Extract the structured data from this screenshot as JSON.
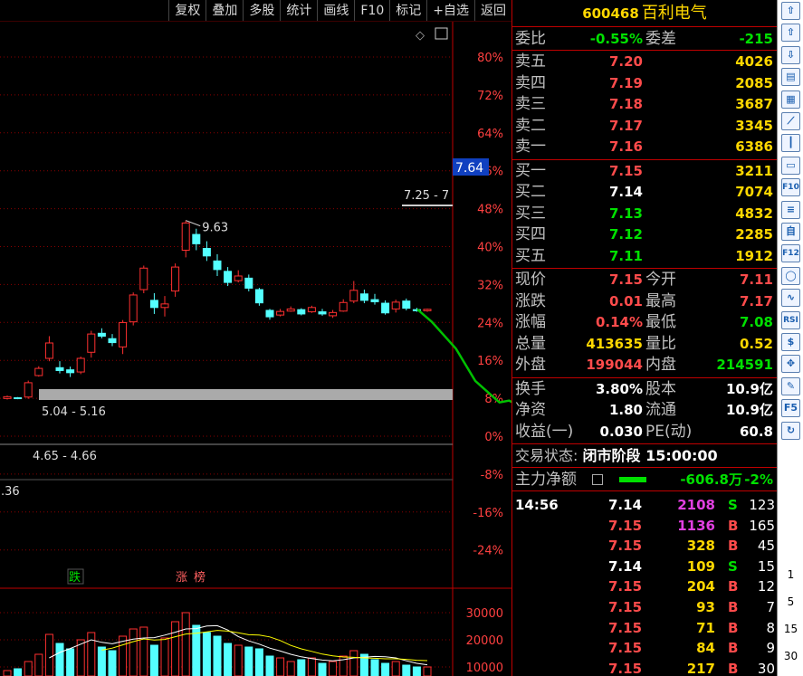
{
  "toolbar": [
    "复权",
    "叠加",
    "多股",
    "统计",
    "画线",
    "F10",
    "标记",
    "+自选",
    "返回"
  ],
  "chart_labels": {
    "current_price": "7.64",
    "high_mark": "9.63",
    "range_label_mid": "5.04 - 5.16",
    "range_label_low": "4.65 - 4.66",
    "range_label_right": "7.25 - 7",
    "left_cut_value": ".36",
    "event_fall": "跌",
    "event_limit1": "涨",
    "event_limit2": "榜"
  },
  "chart_data": {
    "type": "candlestick",
    "pct_axis": [
      "80%",
      "72%",
      "64%",
      "56%",
      "48%",
      "40%",
      "32%",
      "24%",
      "16%",
      "8%",
      "0%",
      "-8%",
      "-16%",
      "-24%"
    ],
    "volume_axis": [
      "30000",
      "20000",
      "10000"
    ],
    "candles": [
      {
        "o": 4.66,
        "c": 4.71,
        "h": 4.74,
        "l": 4.63
      },
      {
        "o": 4.68,
        "c": 4.66,
        "h": 4.7,
        "l": 4.64
      },
      {
        "o": 4.7,
        "c": 5.1,
        "h": 5.16,
        "l": 4.65
      },
      {
        "o": 5.3,
        "c": 5.5,
        "h": 5.56,
        "l": 5.27
      },
      {
        "o": 5.78,
        "c": 6.21,
        "h": 6.4,
        "l": 5.7
      },
      {
        "o": 5.52,
        "c": 5.44,
        "h": 5.7,
        "l": 5.36
      },
      {
        "o": 5.46,
        "c": 5.38,
        "h": 5.55,
        "l": 5.26
      },
      {
        "o": 5.4,
        "c": 5.78,
        "h": 5.83,
        "l": 5.34
      },
      {
        "o": 5.95,
        "c": 6.46,
        "h": 6.55,
        "l": 5.8
      },
      {
        "o": 6.48,
        "c": 6.4,
        "h": 6.62,
        "l": 6.34
      },
      {
        "o": 6.33,
        "c": 6.22,
        "h": 6.46,
        "l": 6.12
      },
      {
        "o": 6.1,
        "c": 6.78,
        "h": 6.85,
        "l": 5.9
      },
      {
        "o": 6.8,
        "c": 7.55,
        "h": 7.62,
        "l": 6.7
      },
      {
        "o": 7.7,
        "c": 8.3,
        "h": 8.37,
        "l": 7.6
      },
      {
        "o": 7.4,
        "c": 7.2,
        "h": 7.6,
        "l": 7.02
      },
      {
        "o": 7.2,
        "c": 7.3,
        "h": 7.52,
        "l": 6.95
      },
      {
        "o": 7.66,
        "c": 8.33,
        "h": 8.43,
        "l": 7.5
      },
      {
        "o": 8.8,
        "c": 9.56,
        "h": 9.63,
        "l": 8.6
      },
      {
        "o": 9.24,
        "c": 8.98,
        "h": 9.4,
        "l": 8.8
      },
      {
        "o": 8.85,
        "c": 8.64,
        "h": 9.05,
        "l": 8.5
      },
      {
        "o": 8.5,
        "c": 8.26,
        "h": 8.69,
        "l": 8.08
      },
      {
        "o": 8.21,
        "c": 7.9,
        "h": 8.33,
        "l": 7.8
      },
      {
        "o": 7.95,
        "c": 8.08,
        "h": 8.24,
        "l": 7.9
      },
      {
        "o": 8.02,
        "c": 7.74,
        "h": 8.12,
        "l": 7.65
      },
      {
        "o": 7.7,
        "c": 7.33,
        "h": 7.75,
        "l": 7.25
      },
      {
        "o": 7.12,
        "c": 6.94,
        "h": 7.16,
        "l": 6.86
      },
      {
        "o": 6.99,
        "c": 7.09,
        "h": 7.16,
        "l": 6.95
      },
      {
        "o": 7.1,
        "c": 7.16,
        "h": 7.23,
        "l": 7.08
      },
      {
        "o": 7.14,
        "c": 7.02,
        "h": 7.18,
        "l": 6.98
      },
      {
        "o": 7.08,
        "c": 7.2,
        "h": 7.25,
        "l": 7.05
      },
      {
        "o": 7.08,
        "c": 7.02,
        "h": 7.16,
        "l": 6.97
      },
      {
        "o": 6.97,
        "c": 7.06,
        "h": 7.13,
        "l": 6.91
      },
      {
        "o": 7.1,
        "c": 7.34,
        "h": 7.43,
        "l": 7.08
      },
      {
        "o": 7.38,
        "c": 7.68,
        "h": 7.94,
        "l": 7.32
      },
      {
        "o": 7.58,
        "c": 7.4,
        "h": 7.7,
        "l": 7.32
      },
      {
        "o": 7.42,
        "c": 7.36,
        "h": 7.58,
        "l": 7.28
      },
      {
        "o": 7.32,
        "c": 7.05,
        "h": 7.4,
        "l": 7.0
      },
      {
        "o": 7.16,
        "c": 7.35,
        "h": 7.42,
        "l": 7.06
      },
      {
        "o": 7.38,
        "c": 7.18,
        "h": 7.45,
        "l": 7.12
      },
      {
        "o": 7.14,
        "c": 7.11,
        "h": 7.19,
        "l": 7.08
      },
      {
        "o": 7.11,
        "c": 7.15,
        "h": 7.17,
        "l": 7.08
      }
    ],
    "volume": [
      3,
      4,
      8,
      12,
      23,
      18,
      15,
      20,
      24,
      16,
      14,
      22,
      26,
      27,
      17,
      21,
      30,
      35,
      28,
      24,
      22,
      18,
      17,
      16,
      15,
      11,
      10,
      8,
      9,
      10,
      7,
      8,
      11,
      14,
      12,
      9,
      7,
      8,
      6,
      5,
      5
    ],
    "forecast": [
      [
        7.15,
        0
      ],
      [
        6.8,
        0.3
      ],
      [
        6.05,
        0.8
      ],
      [
        5.15,
        1.2
      ],
      [
        4.55,
        1.7
      ],
      [
        4.6,
        1.9
      ],
      [
        4.4,
        2.2
      ],
      [
        3.55,
        3.0
      ]
    ]
  },
  "quote": {
    "code": "600468",
    "name": "百利电气",
    "weibi": {
      "label1": "委比",
      "val1": "-0.55%",
      "label2": "委差",
      "val2": "-215"
    },
    "sells": [
      {
        "label": "卖五",
        "price": "7.20",
        "vol": "4026"
      },
      {
        "label": "卖四",
        "price": "7.19",
        "vol": "2085"
      },
      {
        "label": "卖三",
        "price": "7.18",
        "vol": "3687"
      },
      {
        "label": "卖二",
        "price": "7.17",
        "vol": "3345"
      },
      {
        "label": "卖一",
        "price": "7.16",
        "vol": "6386"
      }
    ],
    "buys": [
      {
        "label": "买一",
        "price": "7.15",
        "vol": "3211"
      },
      {
        "label": "买二",
        "price": "7.14",
        "vol": "7074"
      },
      {
        "label": "买三",
        "price": "7.13",
        "vol": "4832"
      },
      {
        "label": "买四",
        "price": "7.12",
        "vol": "2285"
      },
      {
        "label": "买五",
        "price": "7.11",
        "vol": "1912"
      }
    ],
    "stats1": [
      {
        "l1": "现价",
        "v1": "7.15",
        "l2": "今开",
        "v2": "7.11"
      },
      {
        "l1": "涨跌",
        "v1": "0.01",
        "l2": "最高",
        "v2": "7.17"
      },
      {
        "l1": "涨幅",
        "v1": "0.14%",
        "l2": "最低",
        "v2": "7.08"
      },
      {
        "l1": "总量",
        "v1": "413635",
        "l2": "量比",
        "v2": "0.52"
      },
      {
        "l1": "外盘",
        "v1": "199044",
        "l2": "内盘",
        "v2": "214591"
      }
    ],
    "stats2": [
      {
        "l1": "换手",
        "v1": "3.80%",
        "l2": "股本",
        "v2": "10.9亿"
      },
      {
        "l1": "净资",
        "v1": "1.80",
        "l2": "流通",
        "v2": "10.9亿"
      },
      {
        "l1": "收益(一)",
        "v1": "0.030",
        "l2": "PE(动)",
        "v2": "60.8"
      }
    ],
    "status_label": "交易状态:",
    "status_value": "闭市阶段 15:00:00",
    "main_flow_label": "主力净额",
    "main_flow_value": "-606.8万",
    "main_flow_pct": "-2%",
    "ticks": [
      {
        "time": "14:56",
        "price": "7.14",
        "vol": "2108",
        "side": "S",
        "count": "123"
      },
      {
        "time": "",
        "price": "7.15",
        "vol": "1136",
        "side": "B",
        "count": "165"
      },
      {
        "time": "",
        "price": "7.15",
        "vol": "328",
        "side": "B",
        "count": "45"
      },
      {
        "time": "",
        "price": "7.14",
        "vol": "109",
        "side": "S",
        "count": "15"
      },
      {
        "time": "",
        "price": "7.15",
        "vol": "204",
        "side": "B",
        "count": "12"
      },
      {
        "time": "",
        "price": "7.15",
        "vol": "93",
        "side": "B",
        "count": "7"
      },
      {
        "time": "",
        "price": "7.15",
        "vol": "71",
        "side": "B",
        "count": "8"
      },
      {
        "time": "",
        "price": "7.15",
        "vol": "84",
        "side": "B",
        "count": "9"
      },
      {
        "time": "",
        "price": "7.15",
        "vol": "217",
        "side": "B",
        "count": "30"
      }
    ]
  },
  "sidebar": {
    "icons": [
      "up-arrow-icon",
      "up-hollow-arrow-icon",
      "down-hollow-arrow-icon",
      "list-icon",
      "grid-icon",
      "line-chart-icon",
      "candle-icon",
      "window-icon",
      "f10-icon",
      "news-icon",
      "self-icon",
      "f12-icon",
      "circle-icon",
      "wave-icon",
      "rsi-icon",
      "dollar-icon",
      "move-icon",
      "pen-icon",
      "f5-icon",
      "refresh-icon"
    ],
    "labels": [
      "F10",
      "F12",
      "RSI",
      "F5"
    ],
    "nums": [
      "1",
      "5",
      "15",
      "30"
    ]
  },
  "colors": {
    "up": "#ff3030",
    "down": "#54ffff",
    "grid": "#8a0000",
    "ma5": "#ffffff",
    "ma10": "#ffff00",
    "ma20": "#ff40ff",
    "forecast": "#00c000"
  }
}
